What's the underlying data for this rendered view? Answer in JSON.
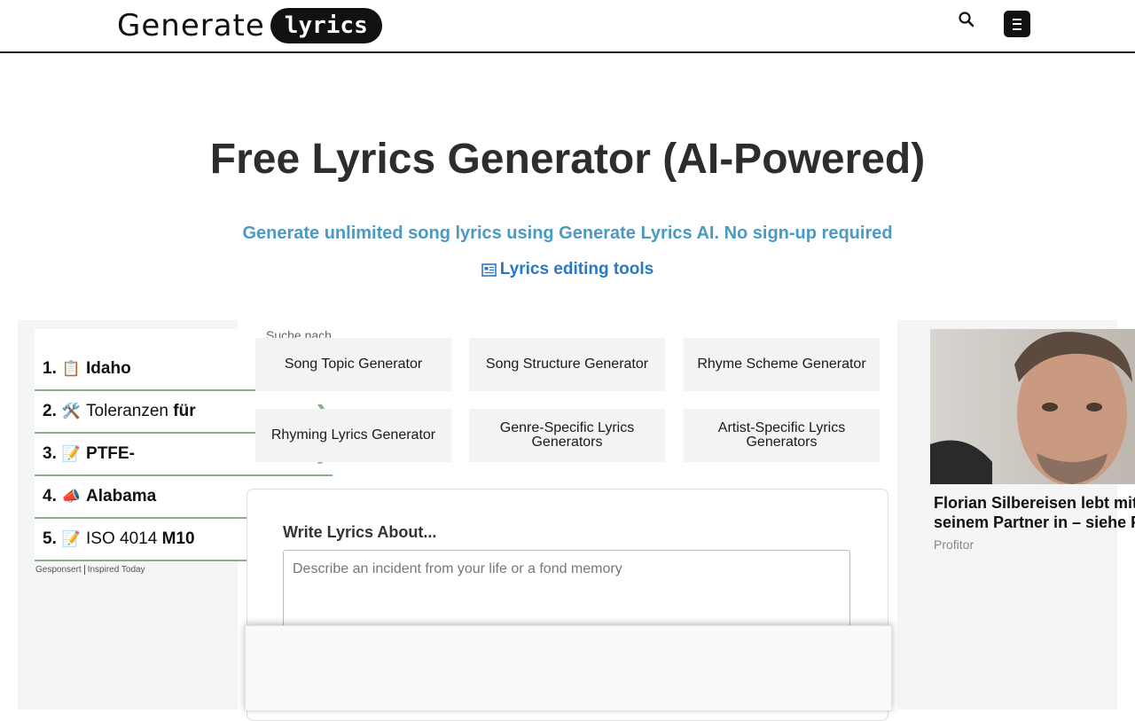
{
  "header": {
    "logo_word": "Generate",
    "logo_pill": "lyrics",
    "search_icon": "search-icon",
    "menu_icon": "hamburger-menu-icon"
  },
  "hero": {
    "title": "Free Lyrics Generator (AI-Powered)",
    "subtitle": "Generate unlimited song lyrics using Generate Lyrics AI. No sign-up required",
    "tools_link": "Lyrics editing tools",
    "tools_icon": "newspaper-icon"
  },
  "left_ad": {
    "items": [
      {
        "num": "1.",
        "emoji": "📋",
        "text": "Idaho",
        "bold": true,
        "suffix": ""
      },
      {
        "num": "2.",
        "emoji": "🛠️",
        "text": "Toleranzen ",
        "bold": false,
        "suffix": "für"
      },
      {
        "num": "3.",
        "emoji": "📝",
        "text": "PTFE-",
        "bold": true,
        "suffix": ""
      },
      {
        "num": "4.",
        "emoji": "📣",
        "text": "Alabama",
        "bold": true,
        "suffix": ""
      },
      {
        "num": "5.",
        "emoji": "📝",
        "text": "ISO 4014 ",
        "bold": false,
        "suffix": "M10"
      }
    ],
    "arrow": "❯",
    "footer_sponsored": "Gesponsert",
    "footer_source": "Inspired Today"
  },
  "search_hint": "Suche nach",
  "tools": [
    "Song Topic Generator",
    "Song Structure Generator",
    "Rhyme Scheme Generator",
    "Rhyming Lyrics Generator",
    "Genre-Specific Lyrics Generators",
    "Artist-Specific Lyrics Generators"
  ],
  "form": {
    "label": "Write Lyrics About...",
    "placeholder": "Describe an incident from your life or a fond memory"
  },
  "right_ad": {
    "headline_line1": "Florian Silbereisen lebt mit",
    "headline_line2": "seinem Partner in – siehe F",
    "source": "Profitor"
  }
}
